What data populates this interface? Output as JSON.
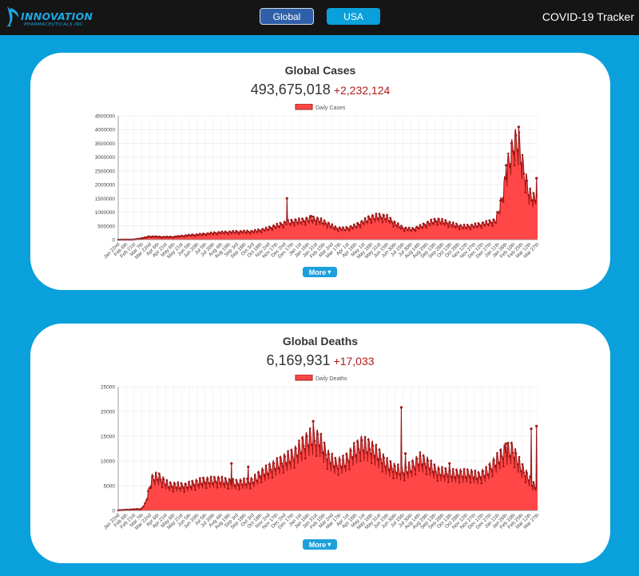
{
  "header": {
    "logo_word": "INNOVATION",
    "logo_sub": "PHARMACEUTICALS INC.",
    "nav": [
      {
        "label": "Global",
        "active": true
      },
      {
        "label": "USA",
        "active": false
      }
    ],
    "title": "COVID-19 Tracker"
  },
  "colors": {
    "header_bg": "#151515",
    "page_bg": "#0aa0db",
    "accent": "#1ca0dc",
    "series_fill": "#ff4747",
    "series_line": "#a11818",
    "delta": "#b11a1a"
  },
  "cases": {
    "title": "Global Cases",
    "total": "493,675,018",
    "delta": "+2,232,124",
    "more_label": "More"
  },
  "deaths": {
    "title": "Global Deaths",
    "total": "6,169,931",
    "delta": "+17,033",
    "more_label": "More"
  },
  "chart_data": [
    {
      "type": "area",
      "series": [
        {
          "name": "Daily Cases"
        }
      ],
      "ylim": [
        0,
        4500000
      ],
      "y_ticks": [
        "0",
        "500000",
        "1000000",
        "1500000",
        "2000000",
        "2500000",
        "3000000",
        "3500000",
        "4000000",
        "4500000"
      ],
      "x_ticks": [
        "Jan 22nd",
        "Feb 6th",
        "Feb 21st",
        "Mar 7th",
        "Mar 22nd",
        "Apr 6th",
        "Apr 21st",
        "May 6th",
        "May 21st",
        "Jun 5th",
        "Jun 20th",
        "Jul 5th",
        "Jul 20th",
        "Aug 4th",
        "Aug 19th",
        "Sep 3rd",
        "Sep 18th",
        "Oct 3rd",
        "Oct 18th",
        "Nov 2nd",
        "Nov 17th",
        "Dec 2nd",
        "Dec 17th",
        "Jan 1st",
        "Jan 16th",
        "Jan 31st",
        "Feb 15th",
        "Mar 2nd",
        "Mar 17th",
        "Apr 1st",
        "Apr 16th",
        "May 1st",
        "May 16th",
        "May 31st",
        "Jun 15th",
        "Jun 30th",
        "Jul 15th",
        "Jul 30th",
        "Aug 14th",
        "Aug 29th",
        "Sep 13th",
        "Sep 28th",
        "Oct 13th",
        "Oct 28th",
        "Nov 12th",
        "Nov 27th",
        "Dec 12th",
        "Dec 27th",
        "Jan 11th",
        "Jan 26th",
        "Feb 10th",
        "Feb 25th",
        "Mar 12th",
        "Mar 27th"
      ],
      "grid": true,
      "legend": "top",
      "profile": [
        [
          0,
          1000
        ],
        [
          0.02,
          3000
        ],
        [
          0.035,
          2500
        ],
        [
          0.06,
          60000
        ],
        [
          0.075,
          120000
        ],
        [
          0.1,
          100000
        ],
        [
          0.13,
          100000
        ],
        [
          0.16,
          150000
        ],
        [
          0.2,
          200000
        ],
        [
          0.24,
          260000
        ],
        [
          0.28,
          290000
        ],
        [
          0.32,
          300000
        ],
        [
          0.35,
          380000
        ],
        [
          0.37,
          480000
        ],
        [
          0.4,
          620000
        ],
        [
          0.42,
          680000
        ],
        [
          0.44,
          700000
        ],
        [
          0.46,
          780000
        ],
        [
          0.48,
          720000
        ],
        [
          0.5,
          580000
        ],
        [
          0.52,
          420000
        ],
        [
          0.54,
          400000
        ],
        [
          0.56,
          480000
        ],
        [
          0.58,
          620000
        ],
        [
          0.6,
          800000
        ],
        [
          0.62,
          860000
        ],
        [
          0.64,
          820000
        ],
        [
          0.66,
          600000
        ],
        [
          0.68,
          420000
        ],
        [
          0.7,
          380000
        ],
        [
          0.72,
          480000
        ],
        [
          0.74,
          620000
        ],
        [
          0.76,
          720000
        ],
        [
          0.78,
          650000
        ],
        [
          0.8,
          550000
        ],
        [
          0.82,
          480000
        ],
        [
          0.84,
          500000
        ],
        [
          0.86,
          550000
        ],
        [
          0.88,
          620000
        ],
        [
          0.9,
          700000
        ],
        [
          0.915,
          1500000
        ],
        [
          0.93,
          2800000
        ],
        [
          0.945,
          3600000
        ],
        [
          0.955,
          3600000
        ],
        [
          0.965,
          2700000
        ],
        [
          0.98,
          1700000
        ],
        [
          1,
          1400000
        ]
      ],
      "spikes": [
        [
          0.402,
          1500000
        ],
        [
          0.46,
          850000
        ],
        [
          0.925,
          2700000
        ],
        [
          0.955,
          4100000
        ],
        [
          0.998,
          2232124
        ]
      ]
    },
    {
      "type": "area",
      "series": [
        {
          "name": "Daily Deaths"
        }
      ],
      "ylim": [
        0,
        25000
      ],
      "y_ticks": [
        "0",
        "5000",
        "10000",
        "15000",
        "20000",
        "25000"
      ],
      "x_ticks": [
        "Jan 22nd",
        "Feb 6th",
        "Feb 21st",
        "Mar 7th",
        "Mar 22nd",
        "Apr 6th",
        "Apr 21st",
        "May 6th",
        "May 21st",
        "Jun 5th",
        "Jun 20th",
        "Jul 5th",
        "Jul 20th",
        "Aug 4th",
        "Aug 19th",
        "Sep 3rd",
        "Sep 18th",
        "Oct 3rd",
        "Oct 18th",
        "Nov 2nd",
        "Nov 17th",
        "Dec 2nd",
        "Dec 17th",
        "Jan 1st",
        "Jan 16th",
        "Jan 31st",
        "Feb 15th",
        "Mar 2nd",
        "Mar 17th",
        "Apr 1st",
        "Apr 16th",
        "May 1st",
        "May 16th",
        "May 31st",
        "Jun 15th",
        "Jun 30th",
        "Jul 15th",
        "Jul 30th",
        "Aug 14th",
        "Aug 29th",
        "Sep 13th",
        "Sep 28th",
        "Oct 13th",
        "Oct 28th",
        "Nov 12th",
        "Nov 27th",
        "Dec 12th",
        "Dec 27th",
        "Jan 11th",
        "Jan 26th",
        "Feb 10th",
        "Feb 25th",
        "Mar 12th",
        "Mar 27th"
      ],
      "grid": true,
      "legend": "top",
      "profile": [
        [
          0,
          50
        ],
        [
          0.03,
          200
        ],
        [
          0.055,
          300
        ],
        [
          0.065,
          1500
        ],
        [
          0.08,
          6500
        ],
        [
          0.095,
          7000
        ],
        [
          0.12,
          5200
        ],
        [
          0.16,
          5000
        ],
        [
          0.2,
          6000
        ],
        [
          0.24,
          6200
        ],
        [
          0.28,
          5600
        ],
        [
          0.32,
          6000
        ],
        [
          0.34,
          7500
        ],
        [
          0.38,
          9500
        ],
        [
          0.42,
          11500
        ],
        [
          0.44,
          13500
        ],
        [
          0.46,
          15000
        ],
        [
          0.48,
          14500
        ],
        [
          0.5,
          11000
        ],
        [
          0.52,
          9500
        ],
        [
          0.54,
          10000
        ],
        [
          0.56,
          12000
        ],
        [
          0.58,
          13500
        ],
        [
          0.6,
          13000
        ],
        [
          0.62,
          11500
        ],
        [
          0.64,
          9500
        ],
        [
          0.66,
          8500
        ],
        [
          0.68,
          8000
        ],
        [
          0.7,
          9000
        ],
        [
          0.72,
          10500
        ],
        [
          0.74,
          9500
        ],
        [
          0.76,
          8000
        ],
        [
          0.8,
          7500
        ],
        [
          0.84,
          7500
        ],
        [
          0.86,
          7000
        ],
        [
          0.88,
          8000
        ],
        [
          0.92,
          12000
        ],
        [
          0.94,
          12500
        ],
        [
          0.96,
          9000
        ],
        [
          0.98,
          6500
        ],
        [
          1,
          4000
        ]
      ],
      "spikes": [
        [
          0.27,
          9500
        ],
        [
          0.31,
          8800
        ],
        [
          0.465,
          18000
        ],
        [
          0.675,
          20800
        ],
        [
          0.685,
          11500
        ],
        [
          0.79,
          9500
        ],
        [
          0.925,
          13500
        ],
        [
          0.985,
          16500
        ],
        [
          0.998,
          17033
        ]
      ]
    }
  ]
}
